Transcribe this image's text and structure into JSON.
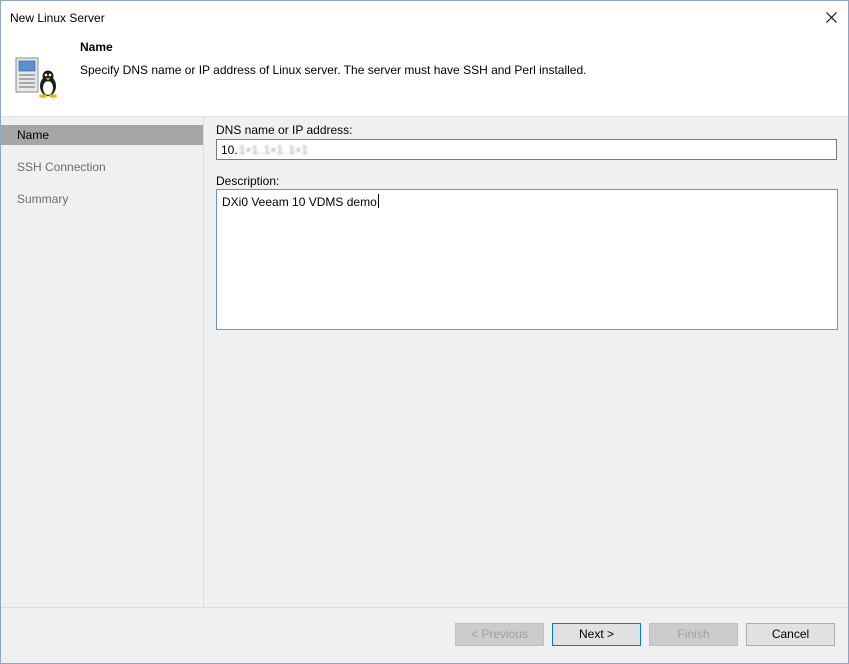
{
  "window": {
    "title": "New Linux Server"
  },
  "header": {
    "title": "Name",
    "description": "Specify DNS name or IP address of Linux server. The server must have SSH and Perl installed."
  },
  "nav": {
    "items": [
      {
        "label": "Name",
        "selected": true
      },
      {
        "label": "SSH Connection",
        "selected": false
      },
      {
        "label": "Summary",
        "selected": false
      }
    ]
  },
  "form": {
    "dns_label": "DNS name or IP address:",
    "dns_value_visible": "10.",
    "dns_value_obscured": "1•1.1•1.1•1",
    "description_label": "Description:",
    "description_value": "DXi0 Veeam 10 VDMS demo"
  },
  "buttons": {
    "previous": "< Previous",
    "next": "Next >",
    "finish": "Finish",
    "cancel": "Cancel"
  },
  "colors": {
    "selected_nav_bg": "#a6a6a6",
    "focus_border": "#6a95c8",
    "default_button_border": "#0078d7"
  }
}
